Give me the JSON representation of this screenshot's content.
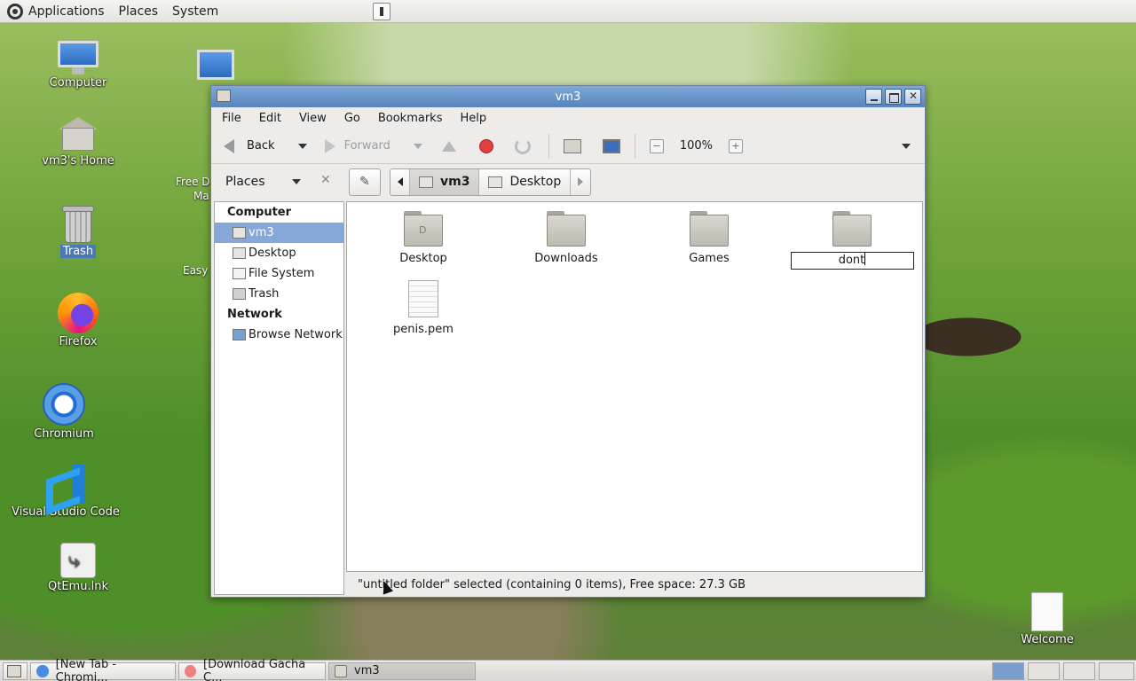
{
  "top_panel": {
    "menus": [
      "Applications",
      "Places",
      "System"
    ]
  },
  "desktop": {
    "icons": [
      {
        "label": "Computer",
        "icon": "computer-icon"
      },
      {
        "label": "vm3's Home",
        "icon": "home-folder-icon"
      },
      {
        "label": "Trash",
        "icon": "trash-icon",
        "selected": true
      },
      {
        "label": "Firefox",
        "icon": "firefox-icon"
      },
      {
        "label": "Chromium",
        "icon": "chromium-icon"
      },
      {
        "label": "Visual Studio Code",
        "icon": "vscode-icon"
      },
      {
        "label": "QtEmu.lnk",
        "icon": "qtemu-icon"
      },
      {
        "label": "Welcome",
        "icon": "document-icon"
      }
    ],
    "partial_labels": [
      "Free D",
      "Ma",
      "Easy"
    ]
  },
  "window": {
    "title": "vm3",
    "menu": [
      "File",
      "Edit",
      "View",
      "Go",
      "Bookmarks",
      "Help"
    ],
    "toolbar": {
      "back": "Back",
      "forward": "Forward",
      "zoom": "100%"
    },
    "sidebar": {
      "header": "Places",
      "sections": [
        {
          "title": "Computer",
          "items": [
            {
              "label": "vm3",
              "selected": true
            },
            {
              "label": "Desktop"
            },
            {
              "label": "File System"
            },
            {
              "label": "Trash"
            }
          ]
        },
        {
          "title": "Network",
          "items": [
            {
              "label": "Browse Network"
            }
          ]
        }
      ]
    },
    "pathbar": [
      "vm3",
      "Desktop"
    ],
    "files": [
      {
        "name": "Desktop",
        "type": "folder",
        "emblem": "D"
      },
      {
        "name": "Downloads",
        "type": "folder"
      },
      {
        "name": "Games",
        "type": "folder"
      },
      {
        "name": "dont",
        "type": "folder",
        "renaming": true
      },
      {
        "name": "penis.pem",
        "type": "file"
      }
    ],
    "status": "\"untitled folder\" selected (containing 0 items), Free space: 27.3 GB"
  },
  "taskbar": {
    "tasks": [
      {
        "label": "[New Tab - Chromi...",
        "icon": "chromium-icon"
      },
      {
        "label": "[Download Gacha C...",
        "icon": "firefox-icon"
      },
      {
        "label": "vm3",
        "icon": "folder-icon",
        "active": true
      }
    ]
  },
  "colors": {
    "titlebar": "#5784bd",
    "selection": "#86a8d8",
    "panel": "#e4e4e1"
  }
}
